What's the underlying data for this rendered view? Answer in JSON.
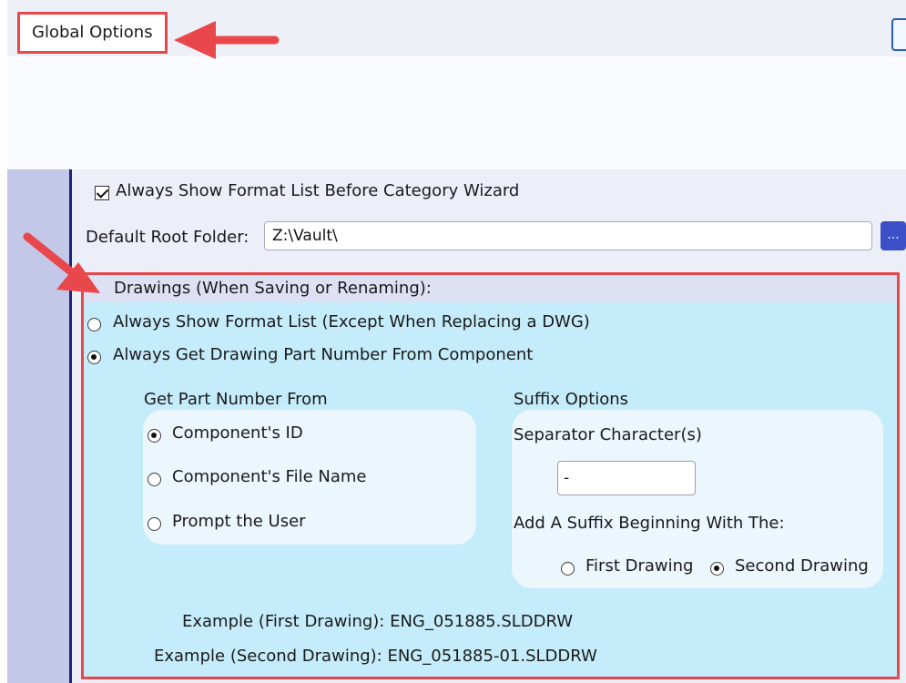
{
  "tab": {
    "label": "Global Options"
  },
  "options": {
    "always_show_format_list_before_wizard": {
      "label": "Always Show Format List Before Category Wizard",
      "checked": true
    },
    "default_root_folder": {
      "label": "Default Root Folder:",
      "value": "Z:\\Vault\\",
      "browse_label": "..."
    }
  },
  "drawings": {
    "heading": "Drawings (When Saving or Renaming):",
    "mode_options": [
      {
        "label": "Always Show Format List (Except When Replacing a DWG)",
        "selected": false
      },
      {
        "label": "Always Get Drawing Part Number From Component",
        "selected": true
      }
    ],
    "part_number": {
      "heading": "Get Part Number From",
      "options": [
        {
          "label": "Component's ID",
          "selected": true
        },
        {
          "label": "Component's File Name",
          "selected": false
        },
        {
          "label": "Prompt the User",
          "selected": false
        }
      ]
    },
    "suffix": {
      "heading": "Suffix Options",
      "separator_label": "Separator Character(s)",
      "separator_value": "-",
      "begin_label": "Add A Suffix Beginning With The:",
      "begin_options": [
        {
          "label": "First Drawing",
          "selected": false
        },
        {
          "label": "Second Drawing",
          "selected": true
        }
      ]
    },
    "examples": {
      "first": "Example (First Drawing): ENG_051885.SLDDRW",
      "second": "Example (Second Drawing): ENG_051885-01.SLDDRW"
    }
  },
  "colors": {
    "highlight_red": "#e8474b",
    "group_background": "#c5ecfb",
    "accent_blue": "#3c4fc6"
  }
}
